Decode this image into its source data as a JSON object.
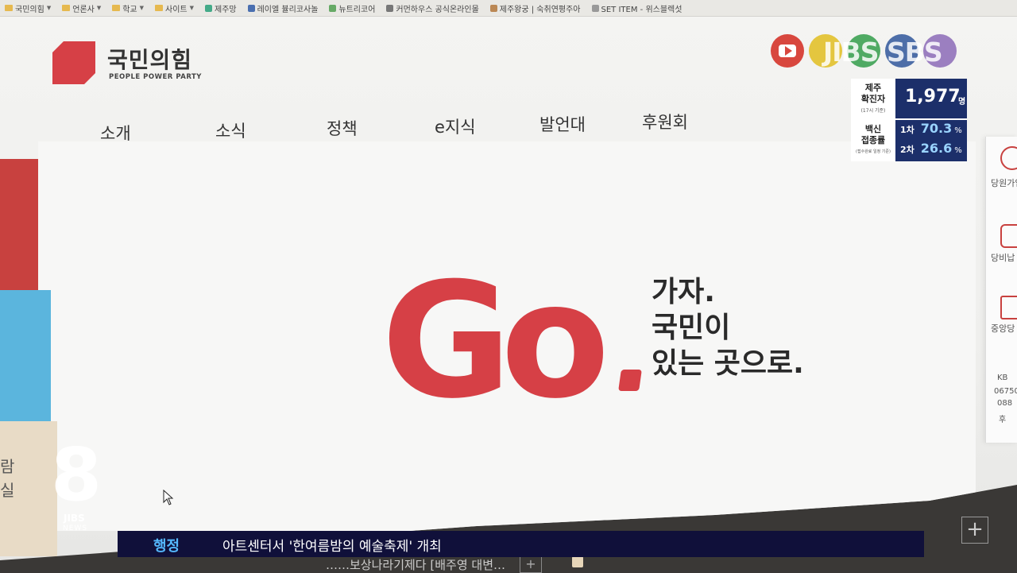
{
  "bookmarks": [
    {
      "label": "국민의힘",
      "type": "folder"
    },
    {
      "label": "언론사",
      "type": "folder"
    },
    {
      "label": "학교",
      "type": "folder"
    },
    {
      "label": "사이트",
      "type": "folder"
    },
    {
      "label": "제주망",
      "type": "site"
    },
    {
      "label": "레이엘 뷸리코사놀",
      "type": "site"
    },
    {
      "label": "뉴트리코어",
      "type": "site"
    },
    {
      "label": "커먼하우스 공식온라인몰",
      "type": "site"
    },
    {
      "label": "제주왕궁 | 숙취연평주아",
      "type": "site"
    },
    {
      "label": "SET ITEM - 위스블렉섯",
      "type": "site"
    }
  ],
  "header": {
    "logo_text": "국민의힘",
    "logo_sub": "PEOPLE POWER PARTY",
    "brand_color": "#d64046"
  },
  "nav": [
    "소개",
    "소식",
    "정책",
    "e지식",
    "발언대",
    "후원회"
  ],
  "social_icons": [
    "youtube-icon",
    "kakaotalk-icon",
    "instagram-icon",
    "facebook-icon",
    "blog-icon"
  ],
  "watermark": "JIBS SBS",
  "covid": {
    "region_label": "제주",
    "confirmed_label": "확진자",
    "confirmed_sub": "(17시 기준)",
    "confirmed_value": "1,977",
    "confirmed_unit": "명",
    "vaccine_label_1": "백신",
    "vaccine_label_2": "접종률",
    "vaccine_sub": "(접수완료 일정 기준)",
    "first_label": "1차",
    "first_value": "70.3",
    "second_label": "2차",
    "second_value": "26.6",
    "percent": "%"
  },
  "hero": {
    "go_text": "Go",
    "slogan_line1": "가자.",
    "slogan_line2": "국민이",
    "slogan_line3": "있는 곳으로.",
    "left_strip_text_1": "람",
    "left_strip_text_2": "실"
  },
  "quick_menu": [
    {
      "label": "당원가입",
      "icon": "user-plus-icon"
    },
    {
      "label": "당비납",
      "icon": "coins-icon"
    },
    {
      "label": "중앙당",
      "icon": "calendar-icon"
    }
  ],
  "quick_text": [
    "KB",
    "06750",
    "088",
    "후"
  ],
  "broadcast": {
    "channel_number": "8",
    "channel_brand": "JIBS",
    "channel_news": "NEWS",
    "ticker_category": "행정",
    "ticker_text": "아트센터서 '한여름밤의 예술축제' 개최",
    "below_text": "……보상나라기제다 [배주영 대변…"
  }
}
